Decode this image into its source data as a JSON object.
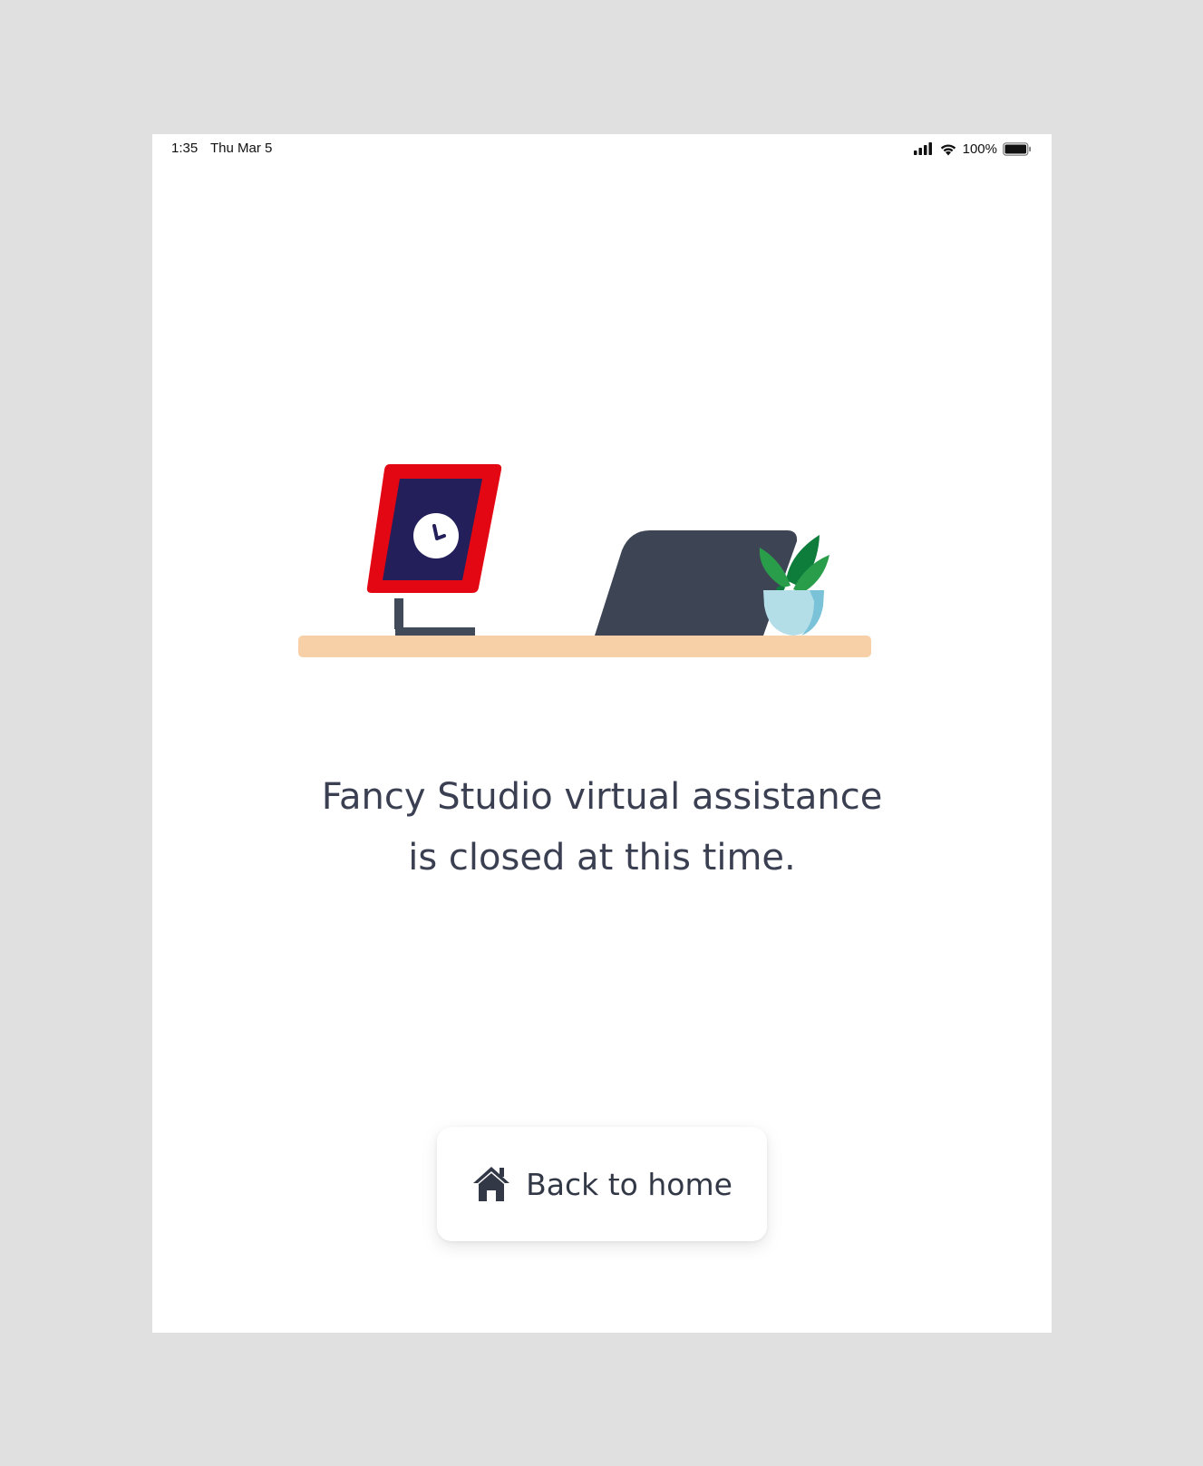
{
  "status_bar": {
    "time": "1:35",
    "date": "Thu Mar 5",
    "battery_percent": "100%",
    "icons": [
      "cellular-signal-icon",
      "wifi-icon",
      "battery-icon"
    ]
  },
  "illustration": {
    "description_icons": [
      "kiosk-clock-icon",
      "desk-icon",
      "plant-icon"
    ],
    "colors": {
      "kiosk_frame": "#e30613",
      "kiosk_screen": "#231f5b",
      "stand": "#414a58",
      "laptop": "#3d4555",
      "desk": "#f7d0a7",
      "plant_leaf_dark": "#0e7d3c",
      "plant_leaf_light": "#2a9d4a",
      "pot": "#b3dee8"
    }
  },
  "message": {
    "line1": "Fancy Studio virtual assistance",
    "line2": "is closed at this time."
  },
  "home_button": {
    "label": "Back to home",
    "icon": "home-icon"
  },
  "colors": {
    "background": "#e0e0e0",
    "screen": "#ffffff",
    "text": "#3b3f52"
  }
}
